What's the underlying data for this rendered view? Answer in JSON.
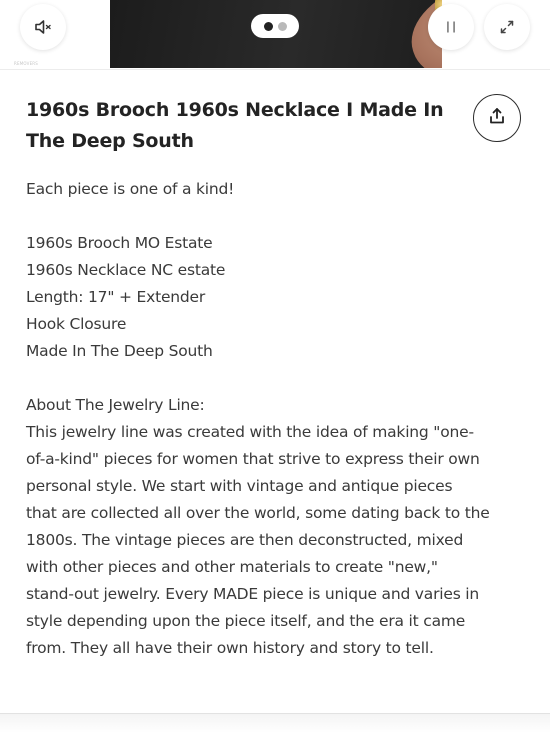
{
  "video": {
    "watermark": "REMOVERS",
    "mute_icon": "speaker-mute-icon",
    "pause_icon": "pause-icon",
    "expand_icon": "expand-icon",
    "slides": {
      "total": 2,
      "active": 1
    }
  },
  "listing": {
    "title": "1960s Brooch 1960s Necklace I Made In The Deep South",
    "share_icon": "share-upload-icon",
    "tagline": "Each piece is one of a kind!",
    "details": [
      "1960s Brooch MO Estate",
      "1960s Necklace NC estate",
      "Length: 17\" + Extender",
      "Hook Closure",
      "Made In The Deep South"
    ],
    "about_heading": "About The Jewelry Line:",
    "about_lines": [
      "This jewelry line was created with the idea of making \"one-",
      "of-a-kind\" pieces for women that strive to express their own",
      "personal style. We start with vintage and antique pieces",
      "that are collected all over the world, some dating back to the",
      "1800s. The vintage pieces are then deconstructed, mixed",
      "with other pieces and other materials to create \"new,\"",
      "stand-out jewelry. Every MADE piece is unique and varies in",
      "style depending upon the piece itself, and the era it came",
      "from. They all have their own history and story to tell."
    ]
  }
}
